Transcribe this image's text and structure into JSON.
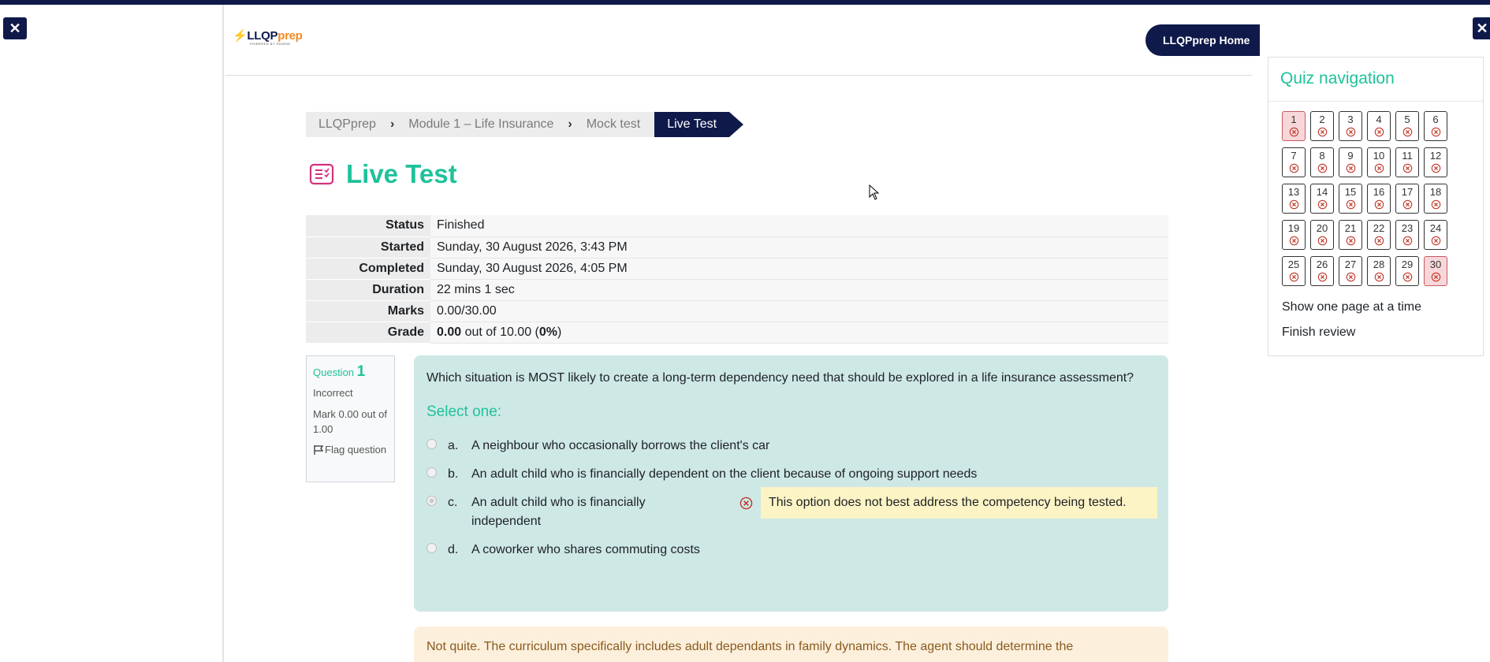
{
  "header": {
    "logo_text_main": "LLQP",
    "logo_text_accent": "prep",
    "logo_subtext": "POWERED BY PADEMI",
    "home_button": "LLQPprep Home"
  },
  "breadcrumb": {
    "items": [
      "LLQPprep",
      "Module 1 – Life Insurance",
      "Mock test"
    ],
    "active": "Live Test"
  },
  "page": {
    "title": "Live Test"
  },
  "summary": {
    "status_label": "Status",
    "status_value": "Finished",
    "started_label": "Started",
    "started_value": "Sunday, 30 August 2026, 3:43 PM",
    "completed_label": "Completed",
    "completed_value": "Sunday, 30 August 2026, 4:05 PM",
    "duration_label": "Duration",
    "duration_value": "22 mins 1 sec",
    "marks_label": "Marks",
    "marks_value": "0.00/30.00",
    "grade_label": "Grade",
    "grade_score": "0.00",
    "grade_out_of": " out of 10.00 (",
    "grade_percent": "0%",
    "grade_close": ")"
  },
  "question_info": {
    "label": "Question ",
    "number": "1",
    "state": "Incorrect",
    "mark": "Mark 0.00 out of 1.00",
    "flag": "Flag question"
  },
  "question": {
    "text": "Which situation is MOST likely to create a long-term dependency need that should be explored in a life insurance assessment?",
    "prompt": "Select one:",
    "answers": [
      {
        "letter": "a.",
        "text": "A neighbour who occasionally borrows the client's car"
      },
      {
        "letter": "b.",
        "text": "An adult child who is financially dependent on the client because of ongoing support needs"
      },
      {
        "letter": "c.",
        "text": "An adult child who is financially independent"
      },
      {
        "letter": "d.",
        "text": "A coworker who shares commuting costs"
      }
    ],
    "selected_feedback": "This option does not best address the competency being tested."
  },
  "general_feedback": {
    "text": "Not quite. The curriculum specifically includes adult dependants in family dynamics. The agent should determine the"
  },
  "quiz_nav": {
    "title": "Quiz navigation",
    "buttons": [
      "1",
      "2",
      "3",
      "4",
      "5",
      "6",
      "7",
      "8",
      "9",
      "10",
      "11",
      "12",
      "13",
      "14",
      "15",
      "16",
      "17",
      "18",
      "19",
      "20",
      "21",
      "22",
      "23",
      "24",
      "25",
      "26",
      "27",
      "28",
      "29",
      "30"
    ],
    "current_buttons": [
      "1",
      "30"
    ],
    "show_one_page": "Show one page at a time",
    "finish_review": "Finish review"
  },
  "icons": {
    "close": "close-icon",
    "quiz": "quiz-icon",
    "flag": "flag-icon",
    "incorrect": "incorrect-x-icon"
  },
  "colors": {
    "navy": "#0f1a4a",
    "accent_green": "#1fc29a",
    "incorrect_red": "#c0392b",
    "question_bg": "#cee8e6",
    "feedback_yellow": "#fdf4c5",
    "general_feedback_bg": "#fcefdc"
  }
}
